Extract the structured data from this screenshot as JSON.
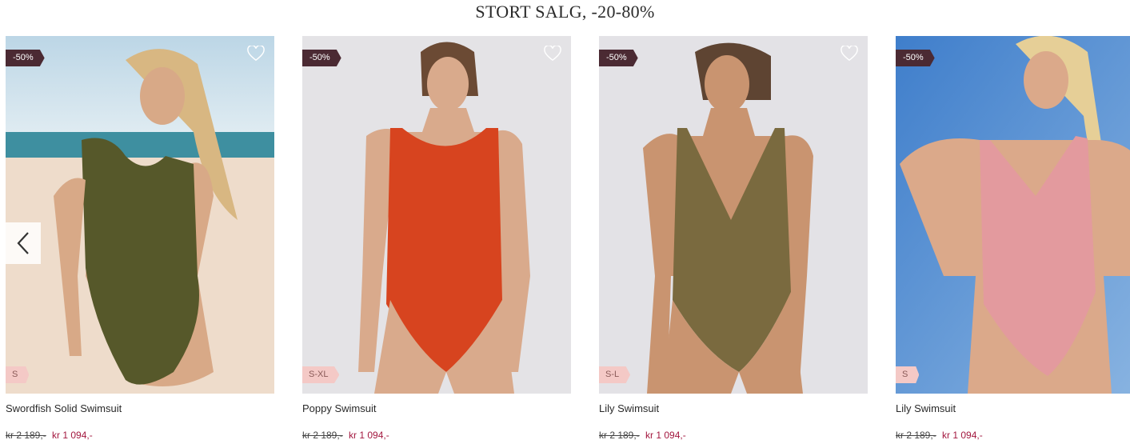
{
  "section": {
    "title": "STORT SALG, -20-80%"
  },
  "icons": {
    "wishlist": "heart-outline-icon",
    "previous": "chevron-left-icon"
  },
  "colors": {
    "discount_badge": "#4b2a33",
    "size_badge": "#f4c9c6",
    "sale_price": "#a3183f"
  },
  "products": [
    {
      "name": "Swordfish Solid Swimsuit",
      "discount": "-50%",
      "sizes": "S",
      "old_price": "kr 2 189,-",
      "new_price": "kr 1 094,-",
      "swimsuit_color": "olive"
    },
    {
      "name": "Poppy Swimsuit",
      "discount": "-50%",
      "sizes": "S-XL",
      "old_price": "kr 2 189,-",
      "new_price": "kr 1 094,-",
      "swimsuit_color": "red-orange"
    },
    {
      "name": "Lily Swimsuit",
      "discount": "-50%",
      "sizes": "S-L",
      "old_price": "kr 2 189,-",
      "new_price": "kr 1 094,-",
      "swimsuit_color": "khaki"
    },
    {
      "name": "Lily Swimsuit",
      "discount": "-50%",
      "sizes": "S",
      "old_price": "kr 2 189,-",
      "new_price": "kr 1 094,-",
      "swimsuit_color": "pink"
    }
  ]
}
